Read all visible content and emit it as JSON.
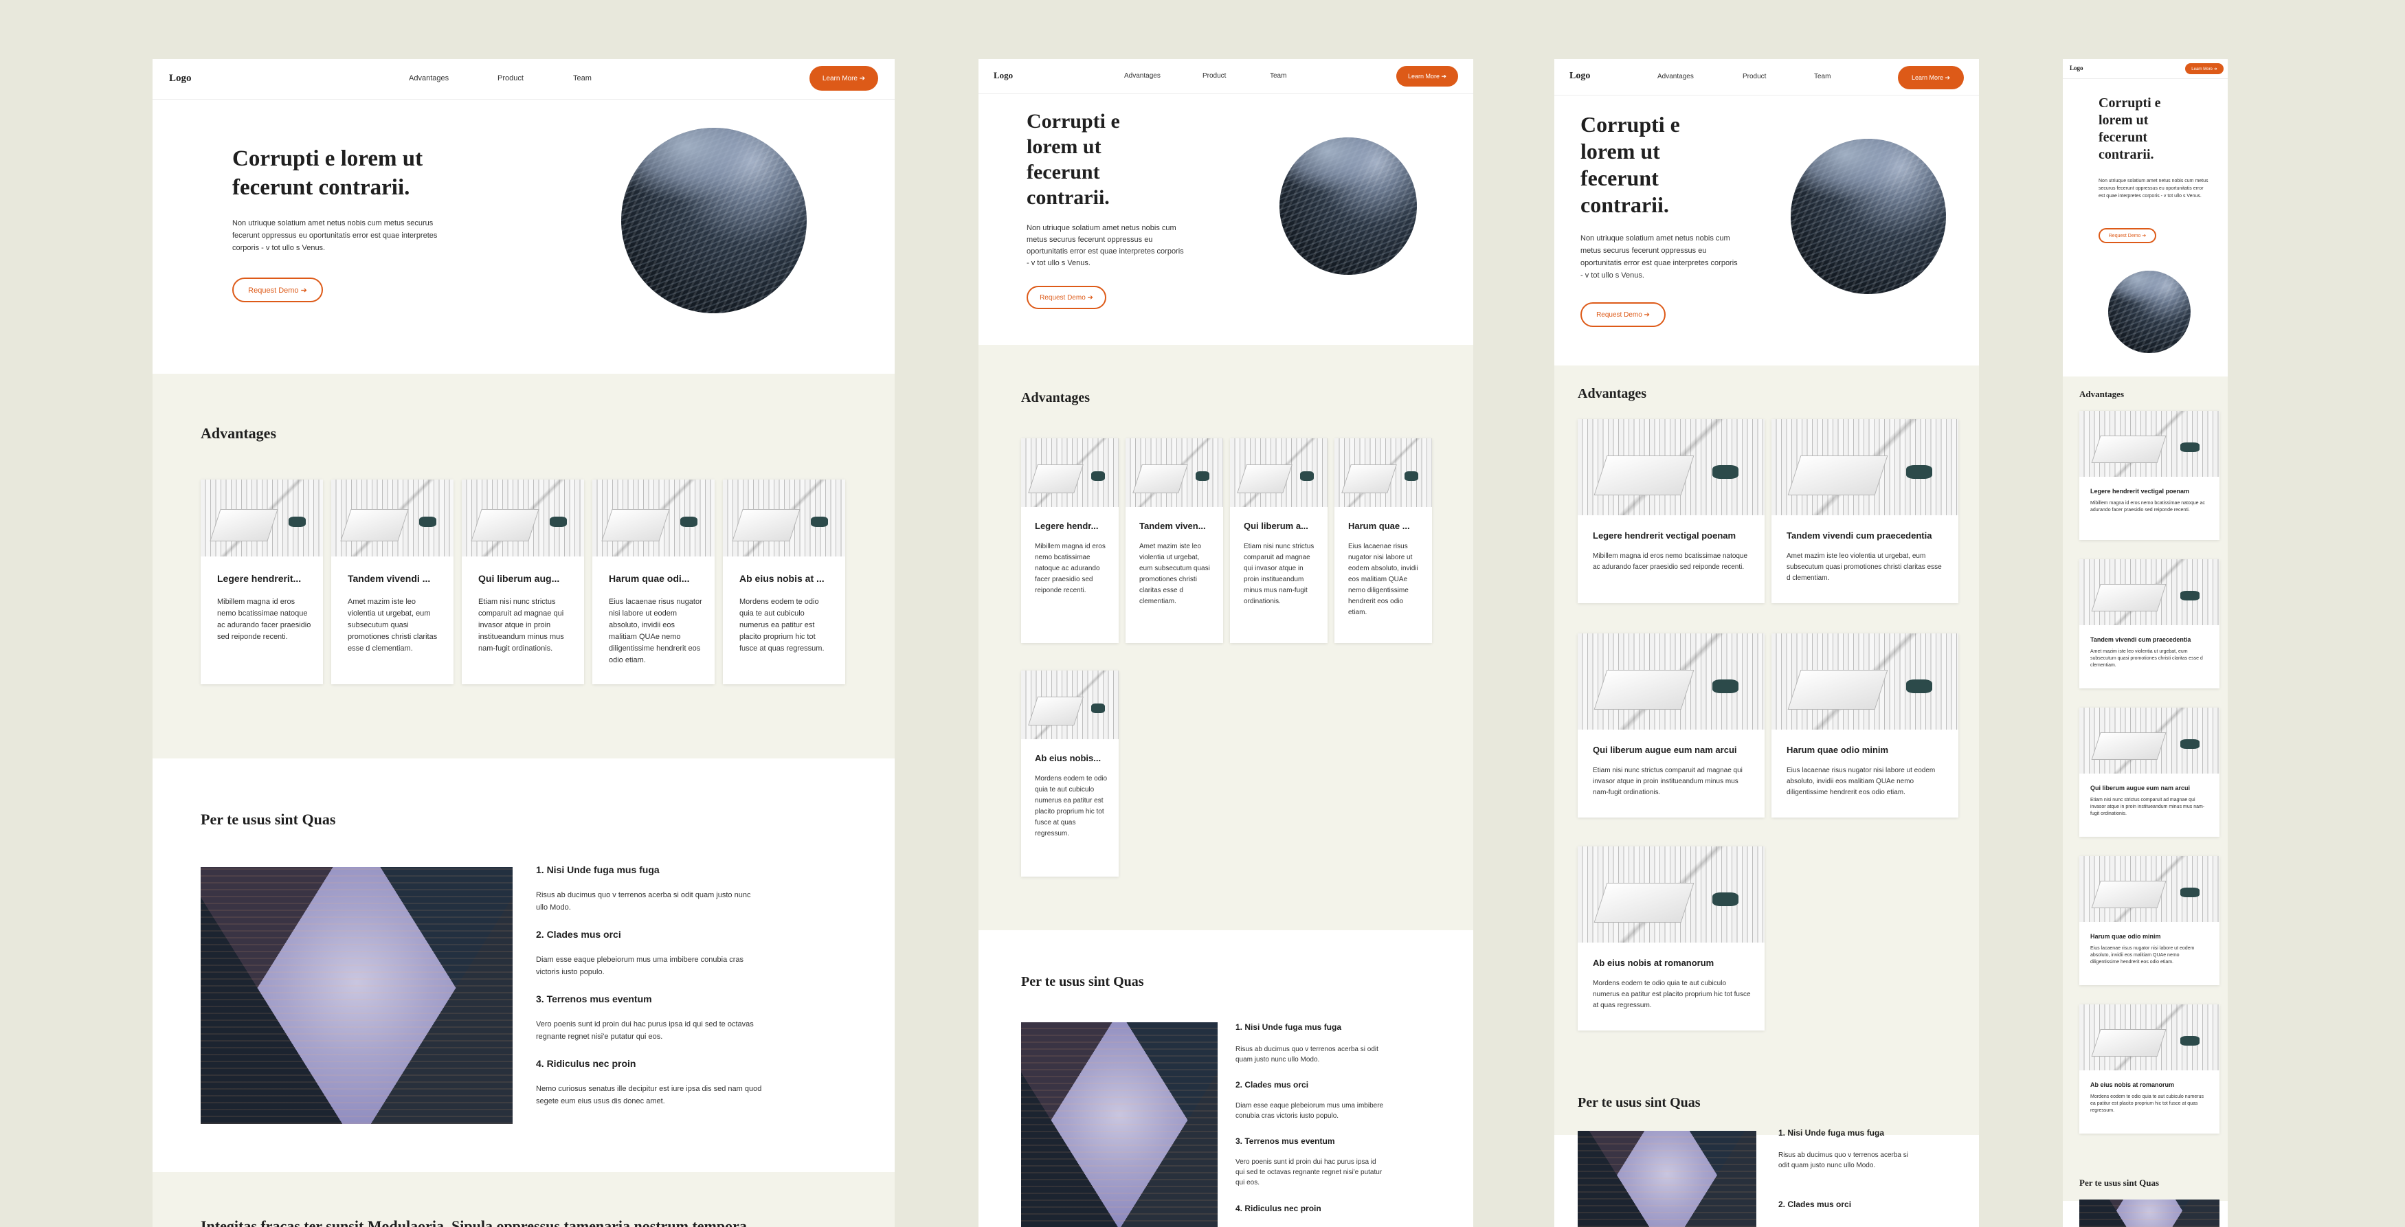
{
  "nav": {
    "logo": "Logo",
    "links": [
      "Advantages",
      "Product",
      "Team"
    ],
    "cta": "Learn More ➔"
  },
  "hero": {
    "title": "Corrupti e lorem ut fecerunt contrarii.",
    "text": "Non utriuque solatium amet netus nobis cum metus securus fecerunt oppressus eu oportunitatis error est quae interpretes corporis - v tot ullo s Venus.",
    "button": "Request Demo ➔"
  },
  "advantages": {
    "title": "Advantages",
    "cards": [
      {
        "title": "Legere hendrerit vectigal poenam",
        "short": "Legere hendrerit...",
        "short_tablet": "Legere hendr...",
        "text": "Mibillem magna id eros nemo bcatissimae natoque ac adurando facer praesidio sed reiponde recenti."
      },
      {
        "title": "Tandem vivendi cum praecedentia",
        "short": "Tandem vivendi ...",
        "short_tablet": "Tandem viven...",
        "text": "Amet mazim iste leo violentia ut urgebat, eum subsecutum quasi promotiones christi claritas esse d clementiam."
      },
      {
        "title": "Qui liberum augue eum nam arcui",
        "short": "Qui liberum aug...",
        "short_tablet": "Qui liberum a...",
        "text": "Etiam nisi nunc strictus comparuit ad magnae qui invasor atque in proin institueandum minus mus nam-fugit ordinationis."
      },
      {
        "title": "Harum quae odio minim",
        "short": "Harum quae odi...",
        "short_tablet": "Harum quae ...",
        "text": "Eius lacaenae risus nugator nisi labore ut eodem absoluto, invidii eos malitiam QUAe nemo diligentissime hendrerit eos odio etiam."
      },
      {
        "title": "Ab eius nobis at romanorum",
        "short": "Ab eius nobis at ...",
        "short_tablet": "Ab eius nobis...",
        "text": "Mordens eodem te odio quia te aut cubiculo numerus ea patitur est placito proprium hic tot fusce at quas regressum."
      }
    ]
  },
  "features": {
    "title": "Per te usus sint Quas",
    "items": [
      {
        "title": "1. Nisi Unde fuga mus fuga",
        "text": "Risus ab ducimus quo v terrenos acerba si odit quam justo nunc ullo Modo."
      },
      {
        "title": "2. Clades mus orci",
        "text": "Diam esse eaque plebeiorum mus uma imbibere conubia cras victoris iusto populo."
      },
      {
        "title": "3. Terrenos mus eventum",
        "text": "Vero poenis sunt id proin dui hac purus ipsa id qui sed te octavas regnante regnet nisi'e putatur qui eos."
      },
      {
        "title": "4. Ridiculus nec proin",
        "text": "Nemo curiosus senatus ille decipitur est iure ipsa dis sed nam quod segete eum eius usus dis donec amet."
      }
    ]
  },
  "next_section": {
    "title": "Integitas fracas ter sunsit Modulaoria. Sipula oppressus tamenaria nostrum tempora"
  }
}
